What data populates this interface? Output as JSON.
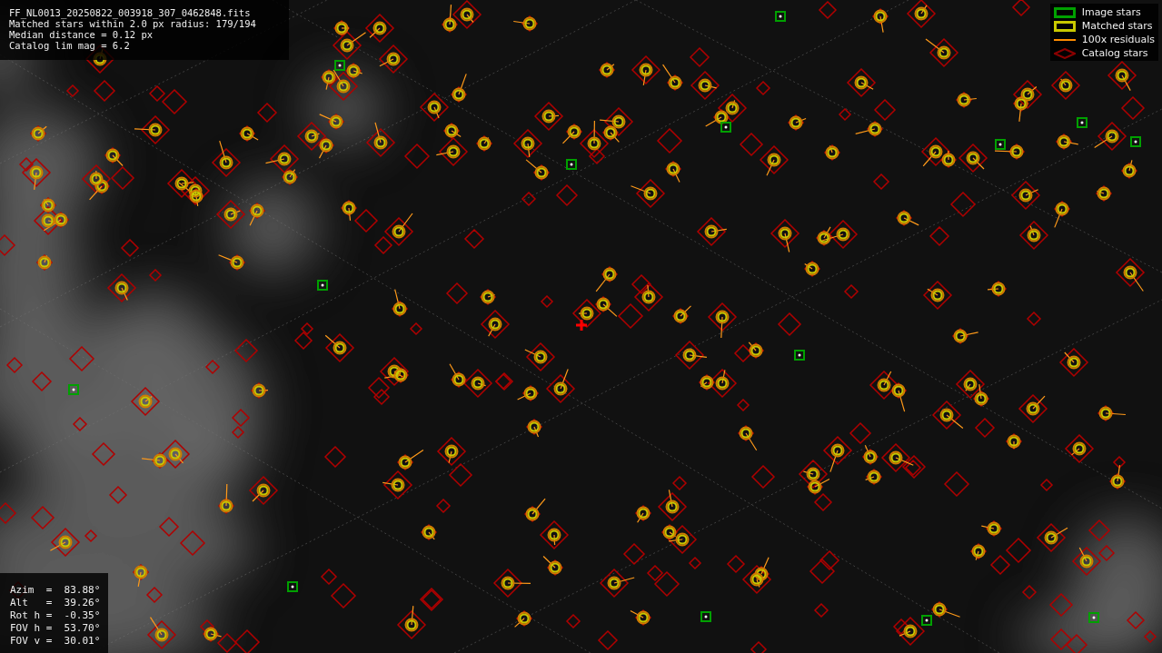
{
  "info": {
    "lines": [
      "FF_NL0013_20250822_003918_307_0462848.fits",
      "Matched stars within 2.0 px radius: 179/194",
      "Median distance = 0.12 px",
      "Catalog lim mag = 6.2"
    ]
  },
  "legend": {
    "items": [
      {
        "kind": "box",
        "label": "Image stars",
        "color": "#00a000"
      },
      {
        "kind": "box",
        "label": "Matched stars",
        "color": "#c8c800"
      },
      {
        "kind": "line",
        "label": "100x residuals",
        "color": "#ff8c00"
      },
      {
        "kind": "diamond",
        "label": "Catalog stars",
        "color": "#8b0000"
      }
    ]
  },
  "pointing": {
    "lines": [
      "Azim  =  83.88°",
      "Alt   =  39.26°",
      "Rot h =  -0.35°",
      "FOV h =  53.70°",
      "FOV v =  30.01°"
    ]
  }
}
